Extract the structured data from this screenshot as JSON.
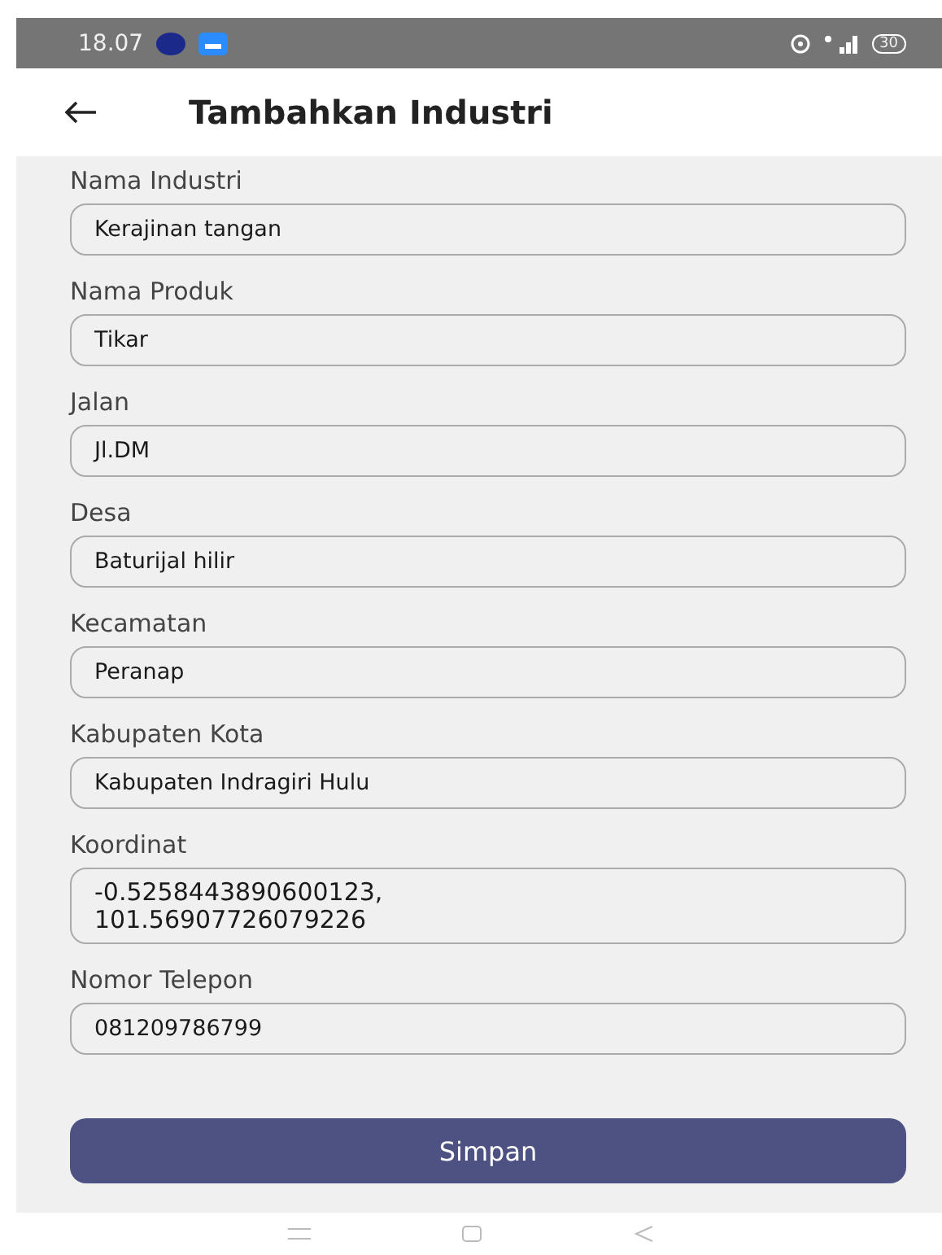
{
  "status_bar": {
    "time": "18.07",
    "battery": "30"
  },
  "header": {
    "title": "Tambahkan Industri"
  },
  "fields": [
    {
      "label": "Nama Industri",
      "value": "Kerajinan tangan"
    },
    {
      "label": "Nama Produk",
      "value": "Tikar"
    },
    {
      "label": "Jalan",
      "value": "Jl.DM"
    },
    {
      "label": "Desa",
      "value": "Baturijal hilir"
    },
    {
      "label": "Kecamatan",
      "value": "Peranap"
    },
    {
      "label": "Kabupaten Kota",
      "value": "Kabupaten Indragiri Hulu"
    },
    {
      "label": "Koordinat",
      "value": "-0.5258443890600123,\n101.56907726079226",
      "multiline": true
    },
    {
      "label": "Nomor Telepon",
      "value": "081209786799"
    }
  ],
  "submit": {
    "label": "Simpan"
  }
}
